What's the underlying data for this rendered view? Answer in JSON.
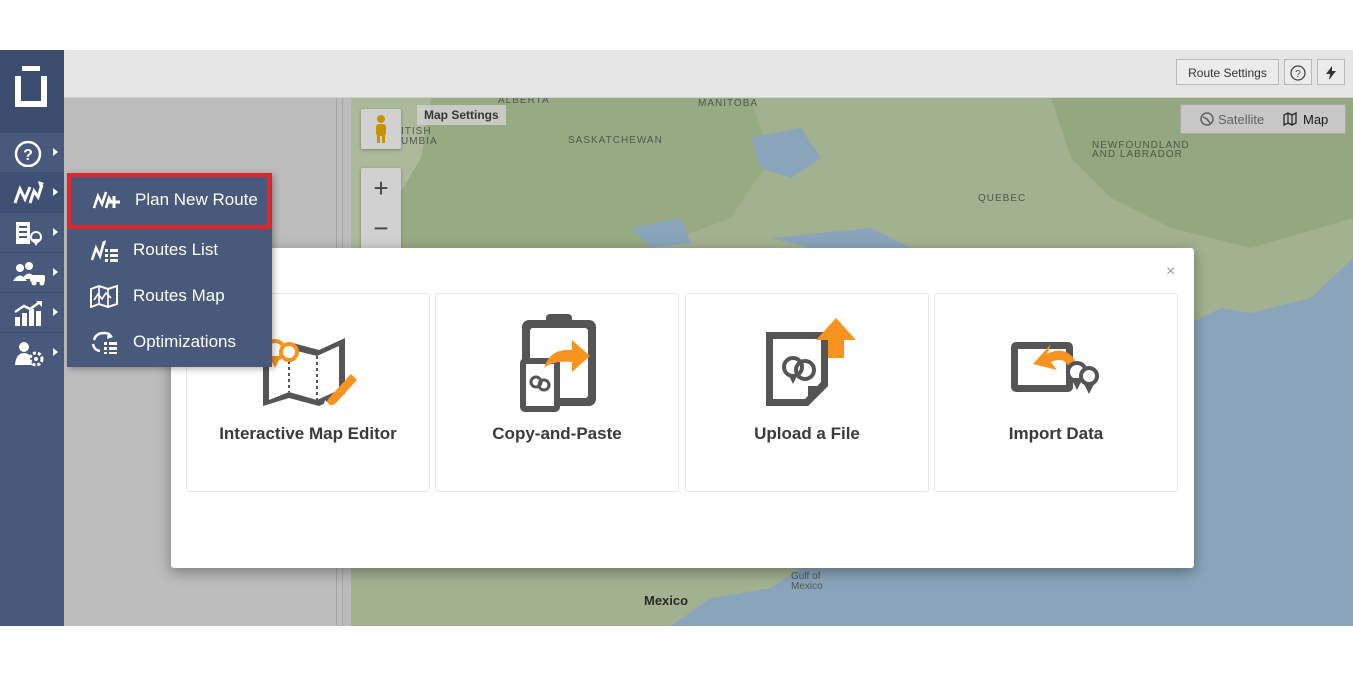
{
  "topbar": {
    "route_settings_label": "Route Settings",
    "help_icon": "question-circle-icon",
    "quick_icon": "lightning-icon"
  },
  "sidebar": {
    "items": [
      {
        "name": "help",
        "icon": "question-circle-icon"
      },
      {
        "name": "routes",
        "icon": "route-icon"
      },
      {
        "name": "orders",
        "icon": "orders-icon"
      },
      {
        "name": "team",
        "icon": "team-icon"
      },
      {
        "name": "analytics",
        "icon": "analytics-icon"
      },
      {
        "name": "settings",
        "icon": "user-settings-icon"
      }
    ]
  },
  "submenu": {
    "items": [
      {
        "label": "Plan New Route",
        "icon": "plan-new-route-icon",
        "highlighted": true
      },
      {
        "label": "Routes List",
        "icon": "routes-list-icon"
      },
      {
        "label": "Routes Map",
        "icon": "routes-map-icon"
      },
      {
        "label": "Optimizations",
        "icon": "optimizations-icon"
      }
    ]
  },
  "map": {
    "settings_label": "Map Settings",
    "satellite_label": "Satellite",
    "map_label": "Map",
    "zoom_in": "+",
    "zoom_out": "−",
    "labels": {
      "alberta": "ALBERTA",
      "manitoba": "MANITOBA",
      "british_columbia_1": "ITISH",
      "british_columbia_2": "UMBIA",
      "saskatchewan": "SASKATCHEWAN",
      "quebec": "QUEBEC",
      "newfoundland_1": "NEWFOUNDLAND",
      "newfoundland_2": "AND LABRADOR",
      "mexico": "Mexico",
      "gulf_1": "Gulf of",
      "gulf_2": "Mexico"
    }
  },
  "modal": {
    "close": "×",
    "options": [
      {
        "label": "Interactive Map Editor",
        "icon": "interactive-map-editor-icon"
      },
      {
        "label": "Copy-and-Paste",
        "icon": "copy-paste-icon"
      },
      {
        "label": "Upload a File",
        "icon": "upload-file-icon"
      },
      {
        "label": "Import Data",
        "icon": "import-data-icon"
      }
    ]
  },
  "colors": {
    "sidebar": "#48597b",
    "accent_orange": "#f7931e",
    "highlight_red": "#e3242b",
    "icon_gray": "#555555"
  }
}
